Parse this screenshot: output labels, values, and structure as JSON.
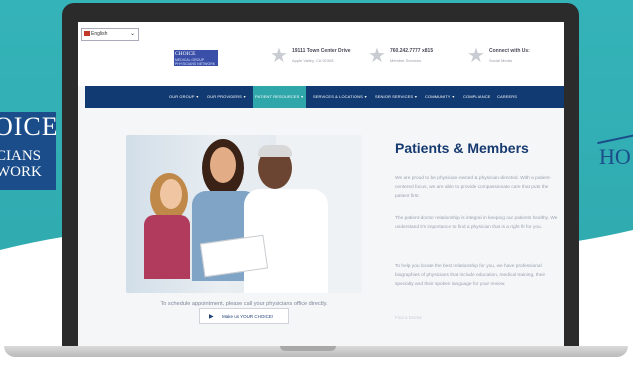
{
  "background_logos": {
    "left": {
      "line1": "OICE",
      "line2": "CIANS",
      "line3": "WORK"
    },
    "right": {
      "text": "HO"
    }
  },
  "site": {
    "language_select": {
      "value": "English"
    },
    "brand": {
      "name": "CHOICE",
      "sub": "MEDICAL GROUP PHYSICIANS NETWORK"
    },
    "header_items": [
      {
        "title": "19111 Town Center Drive",
        "sub": "Apple Valley, CA 92308"
      },
      {
        "title": "760.242.7777 x815",
        "sub": "Member Services"
      },
      {
        "title": "Connect with Us:",
        "sub": "Social Media"
      }
    ],
    "nav": [
      {
        "label": "OUR GROUP",
        "caret": true
      },
      {
        "label": "OUR PROVIDERS",
        "caret": true
      },
      {
        "label": "PATIENT RESOURCES",
        "caret": true,
        "active": true
      },
      {
        "label": "SERVICES & LOCATIONS",
        "caret": true
      },
      {
        "label": "SENIOR SERVICES",
        "caret": true
      },
      {
        "label": "COMMUNITY",
        "caret": true
      },
      {
        "label": "COMPLIANCE",
        "caret": false
      },
      {
        "label": "CAREERS",
        "caret": false
      }
    ],
    "main": {
      "cta_text": "To schedule appointment, please call your physicians office directly.",
      "cta_button": "Make us YOUR CHOICE!",
      "title": "Patients & Members",
      "paragraphs": [
        "We are proud to be physician-owned & physician-directed.  With a patient-centered focus, we are able to provide compassionate care that puts the patient first.",
        "The patient-doctor relationship is integral in keeping our patients healthy.  We understand it's importance to find a physician that is a right fit for you.",
        "To help you locate the best relationship for you, we have professional biographies of physicians that include education, medical training, their specialty and their spoken language for your review."
      ],
      "faded_link": "Find a Doctor"
    }
  },
  "colors": {
    "teal_background": "#34b3b8",
    "navy": "#123a72",
    "active_nav": "#2fa6a9"
  }
}
